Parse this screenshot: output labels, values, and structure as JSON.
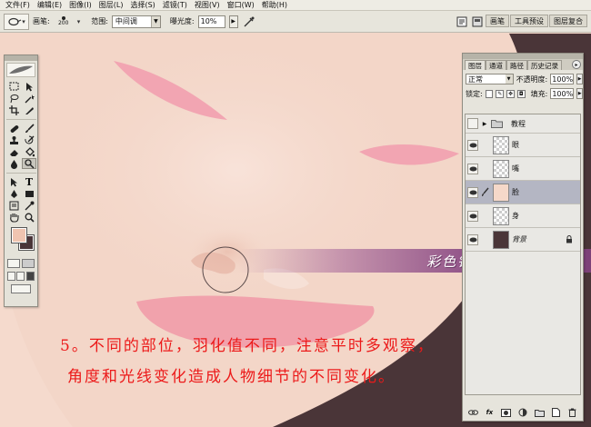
{
  "menu": {
    "items": [
      "文件(F)",
      "编辑(E)",
      "图像(I)",
      "图层(L)",
      "选择(S)",
      "滤镜(T)",
      "视图(V)",
      "窗口(W)",
      "帮助(H)"
    ]
  },
  "options_bar": {
    "tool_icon": "smudge-tool-icon",
    "brush_label": "画笔:",
    "brush_size": "200",
    "range_label": "范围:",
    "range_value": "中间调",
    "exposure_label": "曝光度:",
    "exposure_value": "10%",
    "palette_well_tabs": [
      "画笔",
      "工具预设",
      "图层复合"
    ]
  },
  "toolbox": {
    "foreground_color": "#f0c4b0",
    "background_color": "#4a3538"
  },
  "layers_panel": {
    "tabs": [
      "图层",
      "通道",
      "路径",
      "历史记录"
    ],
    "active_tab": "图层",
    "blend_mode": "正常",
    "opacity_label": "不透明度:",
    "opacity_value": "100%",
    "lock_label": "锁定:",
    "fill_label": "填充:",
    "fill_value": "100%",
    "layers": [
      {
        "name": "教程",
        "kind": "group",
        "visible": false
      },
      {
        "name": "眼",
        "kind": "layer",
        "visible": true,
        "thumb": "checker"
      },
      {
        "name": "嘴",
        "kind": "layer",
        "visible": true,
        "thumb": "checker"
      },
      {
        "name": "脸",
        "kind": "layer",
        "visible": true,
        "thumb": "peach",
        "selected": true
      },
      {
        "name": "身",
        "kind": "layer",
        "visible": true,
        "thumb": "checker"
      },
      {
        "name": "背景",
        "kind": "background",
        "visible": true,
        "thumb": "dark",
        "locked": true
      }
    ]
  },
  "canvas": {
    "banner_text": "彩色铅笔-靖 原创教程",
    "tip_line1": "5。不同的部位，羽化值不同，注意平时多观察，",
    "tip_line2": "角度和光线变化造成人物细节的不同变化。",
    "skin_color": "#f3d6c8",
    "hair_color": "#4a3538",
    "feature_color": "#f2a5b2",
    "text_color": "#ec1a1a"
  }
}
